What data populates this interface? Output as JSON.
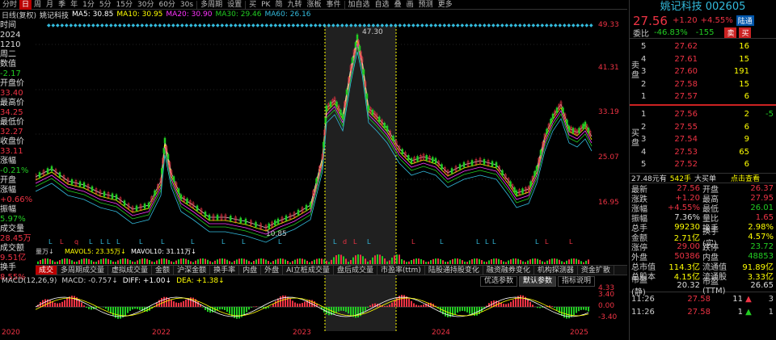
{
  "toolbar": {
    "items": [
      "分时",
      "日",
      "周",
      "月",
      "季",
      "年",
      "1分",
      "5分",
      "15分",
      "30分",
      "60分",
      "30s",
      "多周期",
      "设置",
      "买",
      "PK",
      "简",
      "九转",
      "涨板",
      "事件",
      "加自选",
      "自选",
      "叠",
      "画",
      "预测",
      "更多"
    ],
    "active_index": 1
  },
  "info": {
    "mode": "日线(复权)",
    "name": "姚记科技",
    "ma5": "MA5: 30.85",
    "ma10": "MA10: 30.95",
    "ma20": "MA20: 30.90",
    "ma30": "MA30: 29.46",
    "ma60": "MA60: 26.16"
  },
  "left": [
    {
      "l": "时间",
      "c": "c"
    },
    {
      "l": "2024",
      "c": "c"
    },
    {
      "l": "1210",
      "c": "c"
    },
    {
      "l": "周二",
      "c": "c"
    },
    {
      "l": "数值",
      "c": "c"
    },
    {
      "l": "-2.17",
      "c": "g"
    },
    {
      "l": "开盘价",
      "c": "c"
    },
    {
      "l": "33.40",
      "c": "v"
    },
    {
      "l": "最高价",
      "c": "c"
    },
    {
      "l": "34.25",
      "c": "v"
    },
    {
      "l": "最低价",
      "c": "c"
    },
    {
      "l": "32.27",
      "c": "v"
    },
    {
      "l": "收盘价",
      "c": "c"
    },
    {
      "l": "33.11",
      "c": "v"
    },
    {
      "l": "涨幅",
      "c": "c"
    },
    {
      "l": "-0.21%",
      "c": "g"
    },
    {
      "l": "开盘",
      "c": "c"
    },
    {
      "l": "涨幅",
      "c": "c"
    },
    {
      "l": "+0.66%",
      "c": "v"
    },
    {
      "l": "振幅",
      "c": "c"
    },
    {
      "l": "5.97%",
      "c": "g"
    },
    {
      "l": "成交量",
      "c": "c"
    },
    {
      "l": "28.45万",
      "c": "v"
    },
    {
      "l": "成交额",
      "c": "c"
    },
    {
      "l": "9.51亿",
      "c": "v"
    },
    {
      "l": "换手",
      "c": "c"
    },
    {
      "l": "8.55%",
      "c": "v"
    }
  ],
  "axis": {
    "labels": [
      "49.33",
      "41.31",
      "33.19",
      "25.07",
      "16.95",
      "4.33",
      "3.40",
      "0.00",
      "-3.40"
    ]
  },
  "chart": {
    "high_label": "47.30",
    "low_label": "10.85"
  },
  "volume": {
    "label": "量万↓",
    "mavol5": "MAVOL5: 23.35万↓",
    "mavol10": "MAVOL10: 31.11万↓"
  },
  "vol_tabs": [
    "成交",
    "多周期成交量",
    "虚拟成交量",
    "金额",
    "沪深金额",
    "换手率",
    "内盘",
    "外盘",
    "AI立桩成交量",
    "盘后成交量",
    "市盈率(ttm)",
    "陆股通持股变化",
    "融资融券变化",
    "机构探测器",
    "资金扩散"
  ],
  "macd": {
    "label": "MACD(12,26,9)",
    "macd": "MACD: -0.757↓",
    "diff": "DIFF: +1.00↓",
    "dea": "DEA: +1.38↓"
  },
  "macd_buttons": [
    "优选参数",
    "默认参数",
    "指标说明"
  ],
  "x_labels": [
    "2020",
    "2022",
    "2023",
    "2024",
    "2025"
  ],
  "quote": {
    "title": "姚记科技 002605",
    "price": "27.56",
    "chg": "+1.20",
    "pct": "+4.55%",
    "badge": "陆通",
    "ratio_label": "委比",
    "ratio": "-46.83%",
    "diff": "-155",
    "sell_btn": "卖",
    "buy_btn": "买",
    "ask": [
      {
        "n": "5",
        "p": "27.62",
        "q": "16",
        "d": ""
      },
      {
        "n": "4",
        "p": "27.61",
        "q": "15",
        "d": ""
      },
      {
        "n": "3",
        "p": "27.60",
        "q": "191",
        "d": ""
      },
      {
        "n": "2",
        "p": "27.58",
        "q": "15",
        "d": ""
      },
      {
        "n": "1",
        "p": "27.57",
        "q": "6",
        "d": ""
      }
    ],
    "bid": [
      {
        "n": "1",
        "p": "27.56",
        "q": "2",
        "d": "-5"
      },
      {
        "n": "2",
        "p": "27.55",
        "q": "6",
        "d": ""
      },
      {
        "n": "3",
        "p": "27.54",
        "q": "9",
        "d": ""
      },
      {
        "n": "4",
        "p": "27.53",
        "q": "65",
        "d": ""
      },
      {
        "n": "5",
        "p": "27.52",
        "q": "6",
        "d": ""
      }
    ],
    "ask_side": "卖盘",
    "bid_side": "买盘",
    "trade_bar": [
      "27.48元有",
      "542手",
      "大买单",
      "点击查看"
    ],
    "stats": [
      {
        "k": "最新",
        "v": "27.56",
        "vc": "red",
        "k2": "开盘",
        "v2": "26.37",
        "v2c": "red"
      },
      {
        "k": "涨跌",
        "v": "+1.20",
        "vc": "red",
        "k2": "最高",
        "v2": "27.95",
        "v2c": "red"
      },
      {
        "k": "涨幅",
        "v": "+4.55%",
        "vc": "red",
        "k2": "最低",
        "v2": "26.01",
        "v2c": "green"
      },
      {
        "k": "振幅",
        "v": "7.36%",
        "vc": "white",
        "k2": "量比",
        "v2": "1.65",
        "v2c": "red"
      },
      {
        "k": "总手",
        "v": "99230",
        "vc": "yellow",
        "k2": "换手",
        "v2": "2.98%",
        "v2c": "yellow"
      },
      {
        "k": "金额",
        "v": "2.71亿",
        "vc": "yellow",
        "k2": "换手(实)",
        "v2": "4.57%",
        "v2c": "yellow"
      },
      {
        "k": "涨停",
        "v": "29.00",
        "vc": "red",
        "k2": "跌停",
        "v2": "23.72",
        "v2c": "green"
      },
      {
        "k": "外盘",
        "v": "50386",
        "vc": "red",
        "k2": "内盘",
        "v2": "48853",
        "v2c": "green"
      },
      {
        "k": "总市值",
        "v": "114.3亿",
        "vc": "yellow",
        "k2": "流通值",
        "v2": "91.89亿",
        "v2c": "yellow"
      },
      {
        "k": "总股本",
        "v": "4.15亿",
        "vc": "yellow",
        "k2": "流通股",
        "v2": "3.33亿",
        "v2c": "yellow"
      },
      {
        "k": "市盈(静)",
        "v": "20.32",
        "vc": "white",
        "k2": "市盈(TTM)",
        "v2": "26.65",
        "v2c": "white"
      }
    ],
    "ticks": [
      {
        "t": "11:26",
        "p": "27.58",
        "q": "11",
        "a": "▲",
        "c": "3",
        "ac": "red"
      },
      {
        "t": "11:26",
        "p": "27.58",
        "q": "1",
        "a": "▲",
        "c": "1",
        "ac": "green"
      }
    ]
  },
  "colors": {
    "up": "#e34",
    "down": "#2c2",
    "accent": "#3bd",
    "active": "#b00"
  }
}
